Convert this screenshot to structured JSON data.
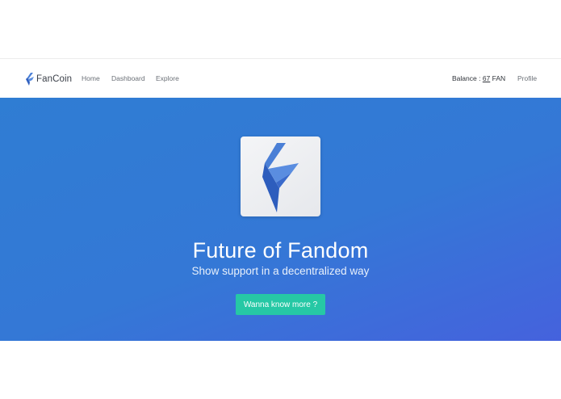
{
  "navbar": {
    "brand": {
      "name": "FanCoin",
      "icon": "fancoin-logo-icon"
    },
    "links": [
      {
        "label": "Home"
      },
      {
        "label": "Dashboard"
      },
      {
        "label": "Explore"
      }
    ],
    "balance": {
      "label": "Balance : ",
      "value": "67",
      "unit": " FAN"
    },
    "profile_label": "Profile"
  },
  "hero": {
    "logo_icon": "fancoin-logo-icon",
    "title": "Future of Fandom",
    "subtitle": "Show support in a decentralized way",
    "cta_label": "Wanna know more ?"
  },
  "colors": {
    "hero_gradient_start": "#2f7dd3",
    "hero_gradient_end": "#4562dd",
    "cta": "#26c8a5",
    "logo_blue": "#3b6fd0"
  }
}
